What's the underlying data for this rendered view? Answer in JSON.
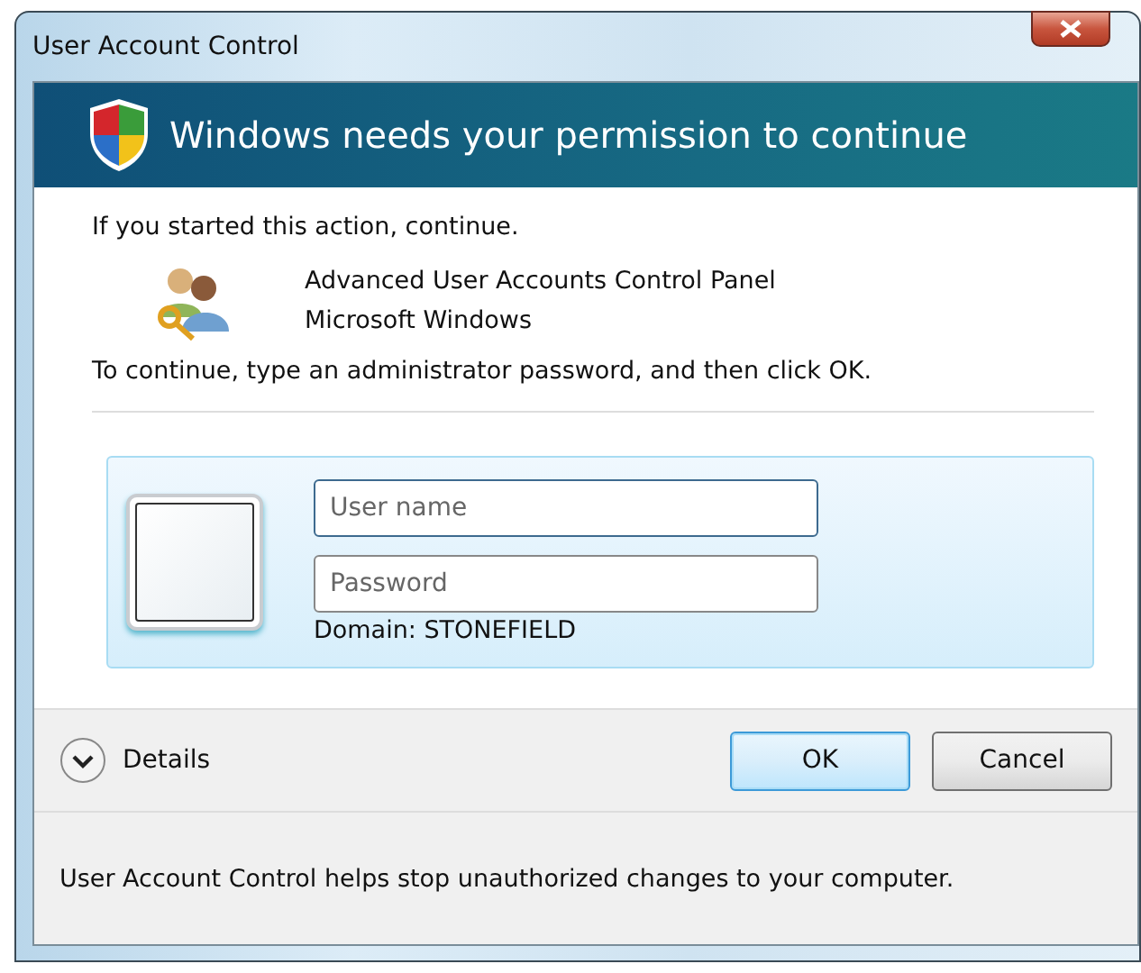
{
  "window": {
    "title": "User Account Control"
  },
  "header": {
    "title": "Windows needs your permission to continue"
  },
  "intro": "If you started this action, continue.",
  "program": {
    "name": "Advanced User Accounts Control Panel",
    "publisher": "Microsoft Windows"
  },
  "instruction": "To continue, type an administrator password, and then click OK.",
  "credentials": {
    "username": {
      "placeholder": "User name"
    },
    "password": {
      "placeholder": "Password"
    },
    "domain": "Domain: STONEFIELD"
  },
  "details": {
    "label": "Details",
    "expanded": false
  },
  "buttons": [
    {
      "label": "OK",
      "default": true
    },
    {
      "label": "Cancel",
      "default": false
    }
  ],
  "footer": "User Account Control helps stop unauthorized changes to your computer."
}
